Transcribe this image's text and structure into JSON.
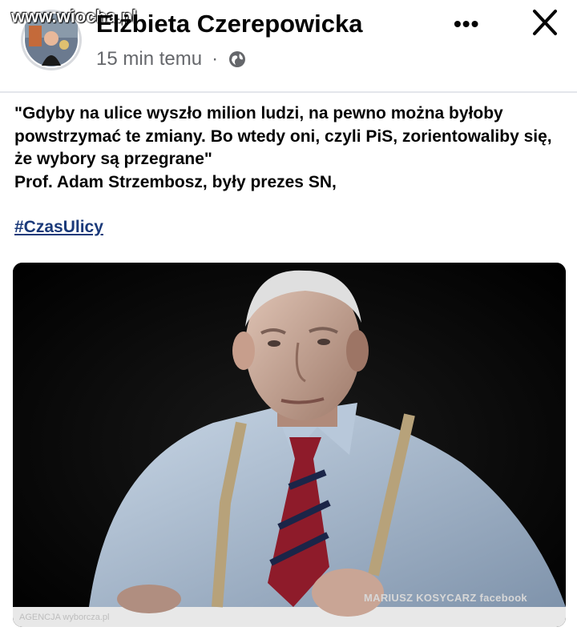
{
  "watermark": "www.wiocha.pl",
  "post": {
    "author": "Elżbieta Czerepowicka",
    "time": "15 min temu",
    "separator": "·",
    "text": "\"Gdyby na ulice wyszło milion ludzi, na pewno można byłoby powstrzymać te zmiany. Bo wtedy oni, czyli PiS, zorientowaliby się, że wybory są przegrane\"\nProf. Adam Strzembosz, były prezes SN,",
    "hashtag": "#CzasUlicy"
  },
  "header": {
    "more_label": "•••"
  },
  "photo": {
    "credit": "MARIUSZ KOSYCARZ facebook",
    "agency": "AGENCJA wyborcza.pl"
  },
  "icons": {
    "privacy": "globe-icon",
    "close": "close-icon",
    "more": "more-options-icon"
  },
  "colors": {
    "text": "#050505",
    "secondary": "#65676b",
    "hashtag": "#1b3a7a",
    "divider": "#e4e6eb"
  }
}
